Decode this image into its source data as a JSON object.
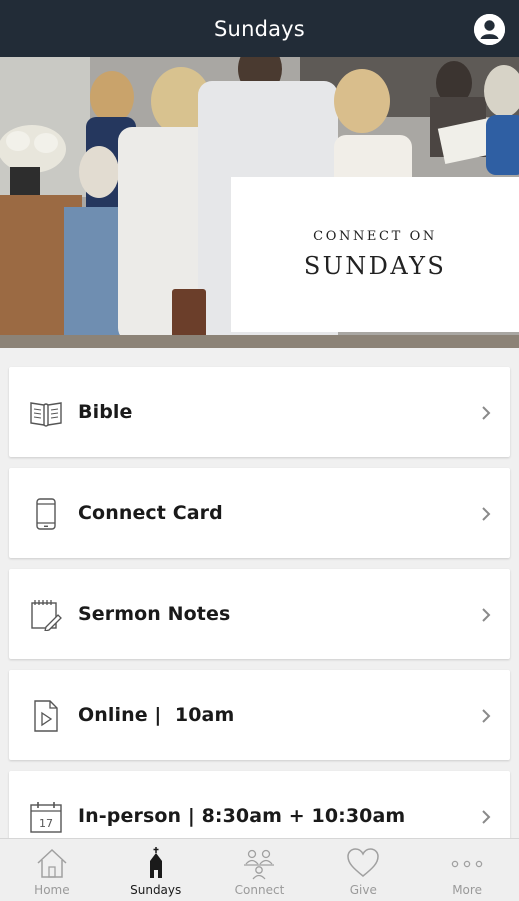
{
  "header": {
    "title": "Sundays",
    "profile_icon": "user-circle-icon"
  },
  "hero": {
    "line1": "CONNECT ON",
    "line2": "SUNDAYS"
  },
  "menu": [
    {
      "label": "Bible",
      "icon": "open-book-icon"
    },
    {
      "label": "Connect Card",
      "icon": "phone-icon"
    },
    {
      "label": "Sermon Notes",
      "icon": "notepad-icon"
    },
    {
      "label": "Online |  10am",
      "icon": "video-file-icon"
    },
    {
      "label": "In-person | 8:30am + 10:30am",
      "icon": "calendar-icon"
    }
  ],
  "tabs": [
    {
      "label": "Home",
      "icon": "home-icon",
      "active": false
    },
    {
      "label": "Sundays",
      "icon": "church-icon",
      "active": true
    },
    {
      "label": "Connect",
      "icon": "people-icon",
      "active": false
    },
    {
      "label": "Give",
      "icon": "heart-icon",
      "active": false
    },
    {
      "label": "More",
      "icon": "more-icon",
      "active": false
    }
  ],
  "colors": {
    "header_bg": "#222c37",
    "tab_active": "#1a1a1a",
    "tab_inactive": "#9a9a9a"
  }
}
